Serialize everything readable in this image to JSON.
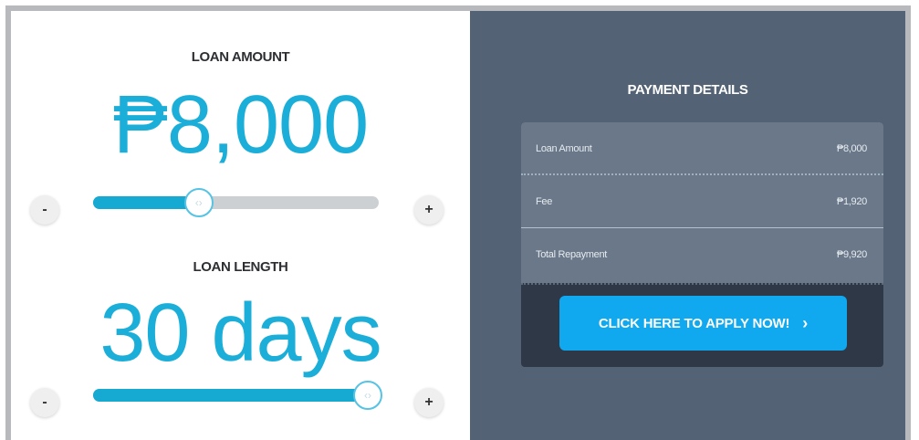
{
  "loan_amount": {
    "label": "LOAN AMOUNT",
    "value": "₱8,000",
    "slider_position": 0.37,
    "decrement_label": "-",
    "increment_label": "+"
  },
  "loan_length": {
    "label": "LOAN LENGTH",
    "value": "30 days",
    "slider_position": 1.0,
    "decrement_label": "-",
    "increment_label": "+"
  },
  "payment_details": {
    "title": "PAYMENT DETAILS",
    "rows": [
      {
        "label": "Loan Amount",
        "value": "₱8,000"
      },
      {
        "label": "Fee",
        "value": "₱1,920"
      },
      {
        "label": "Total Repayment",
        "value": "₱9,920"
      }
    ],
    "apply_button_label": "CLICK HERE TO APPLY NOW!",
    "apply_button_icon": "chevron-right-icon",
    "slider_handle_icon": "double-chevron-icon"
  },
  "colors": {
    "accent": "#1aaed8",
    "slider_fill": "#16a9d2",
    "slider_track": "#cdd0d3",
    "panel_bg": "#536274",
    "card_bg": "#6a7889",
    "button_bg": "#10a8ef"
  }
}
